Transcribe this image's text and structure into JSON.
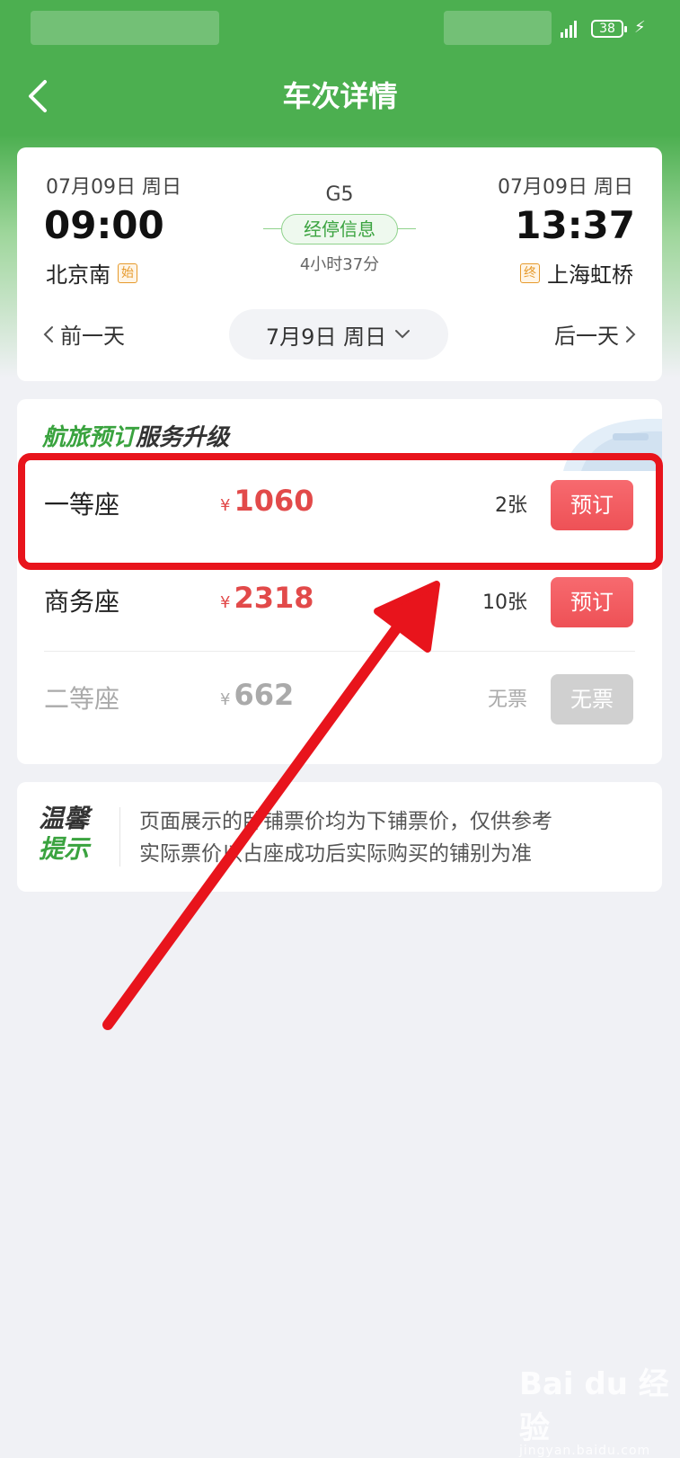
{
  "status_bar": {
    "battery": "38"
  },
  "header": {
    "title": "车次详情"
  },
  "trip": {
    "depart": {
      "date": "07月09日 周日",
      "time": "09:00",
      "station": "北京南",
      "tag": "始"
    },
    "arrive": {
      "date": "07月09日 周日",
      "time": "13:37",
      "station": "上海虹桥",
      "tag": "终"
    },
    "train_no": "G5",
    "stops_label": "经停信息",
    "duration": "4小时37分",
    "prev_day": "前一天",
    "next_day": "后一天",
    "selected_date": "7月9日 周日"
  },
  "promo": {
    "highlight": "航旅预订",
    "rest": "服务升级"
  },
  "seats": [
    {
      "name": "一等座",
      "price": "1060",
      "count": "2张",
      "action": "预订",
      "available": true
    },
    {
      "name": "商务座",
      "price": "2318",
      "count": "10张",
      "action": "预订",
      "available": true
    },
    {
      "name": "二等座",
      "price": "662",
      "count": "无票",
      "action": "无票",
      "available": false
    }
  ],
  "currency": "¥",
  "tip": {
    "label_1": "温馨",
    "label_2": "提示",
    "line_1": "页面展示的卧铺票价均为下铺票价，仅供参考",
    "line_2": "实际票价以占座成功后实际购买的铺别为准"
  },
  "watermark": {
    "logo": "Bai du 经验",
    "url": "jingyan.baidu.com"
  },
  "colors": {
    "header_green": "#4caf50",
    "accent_green": "#3aa33f",
    "price_red": "#e24a4a",
    "book_button": "#ee5156",
    "highlight_red": "#e8141c"
  }
}
